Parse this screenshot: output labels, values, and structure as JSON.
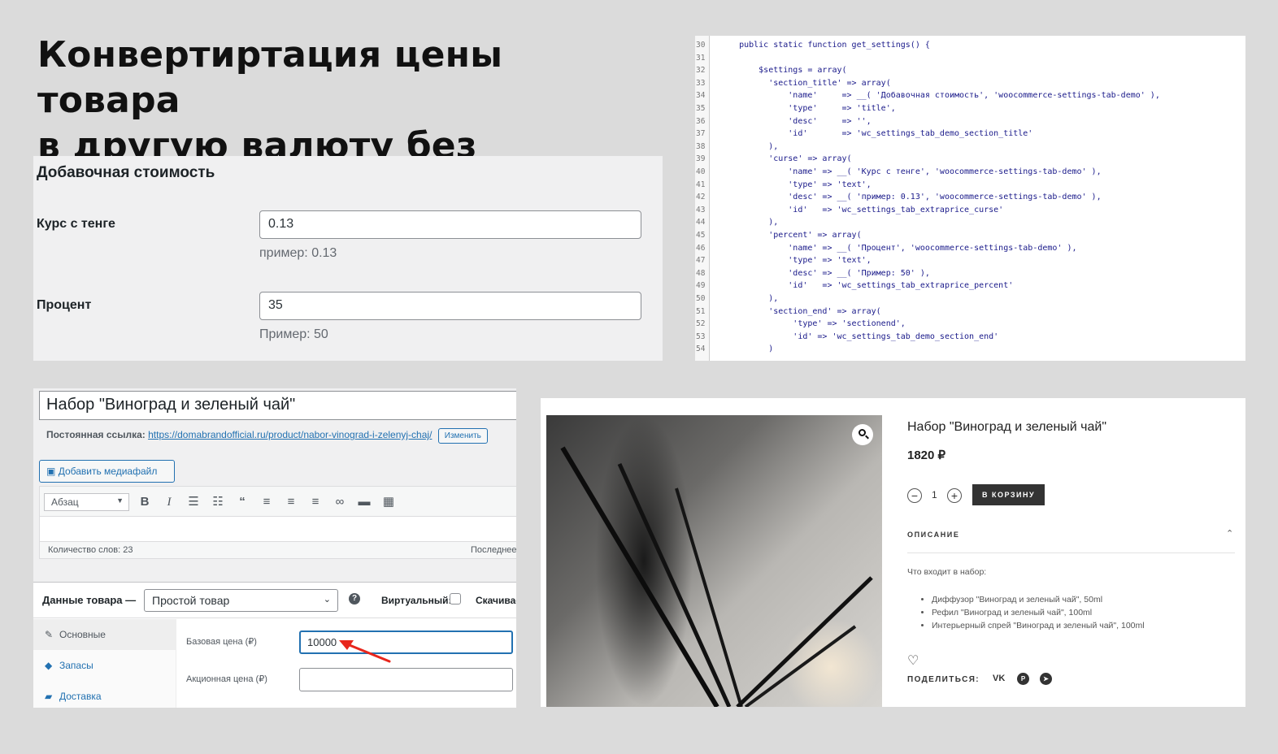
{
  "heading": {
    "line1": "Конвертиртация цены товара",
    "line2": "в другую валюту без плагина"
  },
  "settings_panel": {
    "section_title": "Добавочная стоимость",
    "fields": [
      {
        "label": "Курс с тенге",
        "value": "0.13",
        "desc": "пример: 0.13"
      },
      {
        "label": "Процент",
        "value": "35",
        "desc": "Пример: 50"
      }
    ]
  },
  "code_panel": {
    "lines": [
      {
        "n": "30",
        "t": "    public static function get_settings() {"
      },
      {
        "n": "31",
        "t": ""
      },
      {
        "n": "32",
        "t": "        $settings = array("
      },
      {
        "n": "33",
        "t": "          'section_title' => array("
      },
      {
        "n": "34",
        "t": "              'name'     => __( 'Добавочная стоимость', 'woocommerce-settings-tab-demo' ),"
      },
      {
        "n": "35",
        "t": "              'type'     => 'title',"
      },
      {
        "n": "36",
        "t": "              'desc'     => '',"
      },
      {
        "n": "37",
        "t": "              'id'       => 'wc_settings_tab_demo_section_title'"
      },
      {
        "n": "38",
        "t": "          ),"
      },
      {
        "n": "39",
        "t": "          'curse' => array("
      },
      {
        "n": "40",
        "t": "              'name' => __( 'Курс с тенге', 'woocommerce-settings-tab-demo' ),"
      },
      {
        "n": "41",
        "t": "              'type' => 'text',"
      },
      {
        "n": "42",
        "t": "              'desc' => __( 'пример: 0.13', 'woocommerce-settings-tab-demo' ),"
      },
      {
        "n": "43",
        "t": "              'id'   => 'wc_settings_tab_extraprice_curse'"
      },
      {
        "n": "44",
        "t": "          ),"
      },
      {
        "n": "45",
        "t": "          'percent' => array("
      },
      {
        "n": "46",
        "t": "              'name' => __( 'Процент', 'woocommerce-settings-tab-demo' ),"
      },
      {
        "n": "47",
        "t": "              'type' => 'text',"
      },
      {
        "n": "48",
        "t": "              'desc' => __( 'Пример: 50' ),"
      },
      {
        "n": "49",
        "t": "              'id'   => 'wc_settings_tab_extraprice_percent'"
      },
      {
        "n": "50",
        "t": "          ),"
      },
      {
        "n": "51",
        "t": "          'section_end' => array("
      },
      {
        "n": "52",
        "t": "               'type' => 'sectionend',"
      },
      {
        "n": "53",
        "t": "               'id' => 'wc_settings_tab_demo_section_end'"
      },
      {
        "n": "54",
        "t": "          )"
      }
    ]
  },
  "editor_panel": {
    "product_title": "Набор \"Виноград и зеленый чай\"",
    "permalink_label": "Постоянная ссылка:",
    "permalink_url": "https://domabrandofficial.ru/product/nabor-vinograd-i-zelenyj-chaj/",
    "permalink_edit": "Изменить",
    "add_media": "Добавить медиафайл",
    "format_select": "Абзац",
    "word_count": "Количество слов: 23",
    "last_edit": "Последнее",
    "product_data_label": "Данные товара —",
    "product_type": "Простой товар",
    "virtual_label": "Виртуальный:",
    "downloadable_label": "Скачиваемый",
    "tabs": [
      "Основные",
      "Запасы",
      "Доставка"
    ],
    "regular_price_label": "Базовая цена (₽)",
    "regular_price_value": "10000",
    "sale_price_label": "Акционная цена (₽)",
    "sale_price_value": ""
  },
  "store_panel": {
    "product_title": "Набор \"Виноград и зеленый чай\"",
    "price": "1820 ₽",
    "qty": "1",
    "add_to_cart": "В КОРЗИНУ",
    "description_heading": "ОПИСАНИЕ",
    "includes_label": "Что входит в набор:",
    "items": [
      "Диффузор \"Виноград и зеленый чай\", 50ml",
      "Рефил \"Виноград и зеленый чай\", 100ml",
      "Интерьерный спрей \"Виноград и зеленый чай\", 100ml"
    ],
    "share_label": "ПОДЕЛИТЬСЯ:",
    "accent": "#333333"
  }
}
